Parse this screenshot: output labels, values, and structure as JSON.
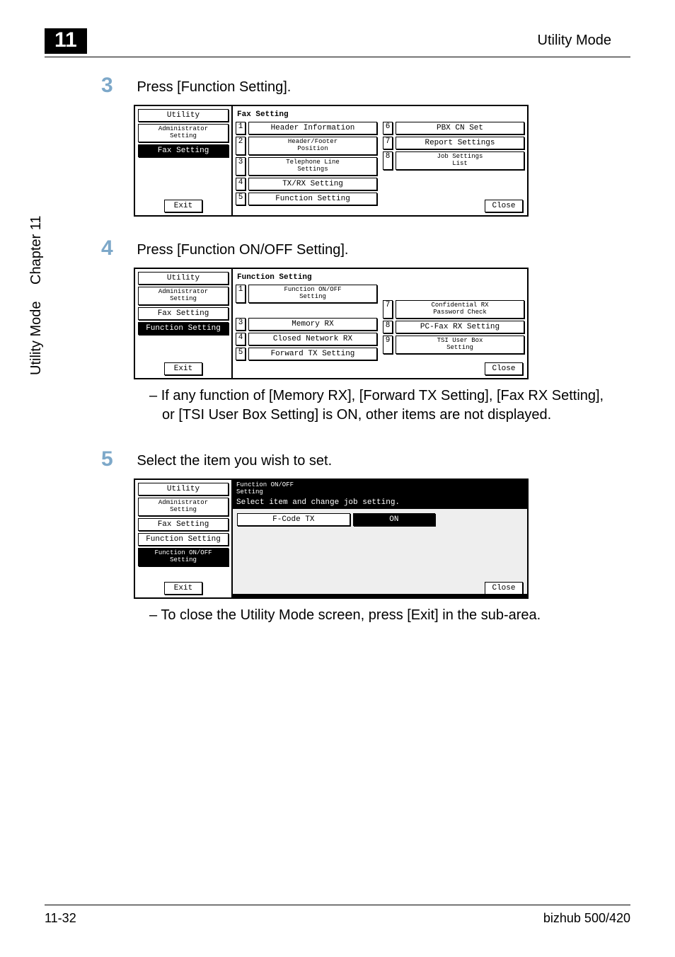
{
  "page": {
    "tab_number": "11",
    "header_right": "Utility Mode",
    "sidebar_main": "Utility Mode",
    "sidebar_chapter": "Chapter 11"
  },
  "step3": {
    "num": "3",
    "text": "Press [Function Setting].",
    "left": {
      "utility": "Utility",
      "admin": "Administrator\nSetting",
      "fax_setting": "Fax Setting",
      "exit": "Exit"
    },
    "right": {
      "title": "Fax Setting",
      "r1": {
        "n": "1",
        "label": "Header Information"
      },
      "r2": {
        "n": "2",
        "label": "Header/Footer\nPosition"
      },
      "r3": {
        "n": "3",
        "label": "Telephone Line\nSettings"
      },
      "r4": {
        "n": "4",
        "label": "TX/RX Setting"
      },
      "r5": {
        "n": "5",
        "label": "Function Setting"
      },
      "r6": {
        "n": "6",
        "label": "PBX CN Set"
      },
      "r7": {
        "n": "7",
        "label": "Report Settings"
      },
      "r8": {
        "n": "8",
        "label": "Job Settings\nList"
      },
      "close": "Close"
    }
  },
  "step4": {
    "num": "4",
    "text": "Press [Function ON/OFF Setting].",
    "left": {
      "utility": "Utility",
      "admin": "Administrator\nSetting",
      "fax_setting": "Fax Setting",
      "func_setting": "Function Setting",
      "exit": "Exit"
    },
    "right": {
      "title": "Function Setting",
      "r1": {
        "n": "1",
        "label": "Function ON/OFF\nSetting"
      },
      "r3": {
        "n": "3",
        "label": "Memory RX"
      },
      "r4": {
        "n": "4",
        "label": "Closed Network RX"
      },
      "r5": {
        "n": "5",
        "label": "Forward TX Setting"
      },
      "r7": {
        "n": "7",
        "label": "Confidential RX\nPassword Check"
      },
      "r8": {
        "n": "8",
        "label": "PC-Fax RX Setting"
      },
      "r9": {
        "n": "9",
        "label": "TSI User Box\nSetting"
      },
      "close": "Close"
    },
    "note": "If any function of [Memory RX], [Forward TX Setting], [Fax RX Setting], or [TSI User Box Setting] is ON, other items are not displayed."
  },
  "step5": {
    "num": "5",
    "text": "Select the item you wish to set.",
    "left": {
      "utility": "Utility",
      "admin": "Administrator\nSetting",
      "fax_setting": "Fax Setting",
      "func_setting": "Function Setting",
      "func_onoff": "Function ON/OFF\nSetting",
      "exit": "Exit"
    },
    "right": {
      "title_line1": "Function ON/OFF\nSetting",
      "title_line2": "Select item and change job setting.",
      "item_name": "F-Code TX",
      "item_state": "ON",
      "close": "Close"
    },
    "note": "To close the Utility Mode screen, press [Exit] in the sub-area."
  },
  "footer": {
    "left": "11-32",
    "right": "bizhub 500/420"
  }
}
